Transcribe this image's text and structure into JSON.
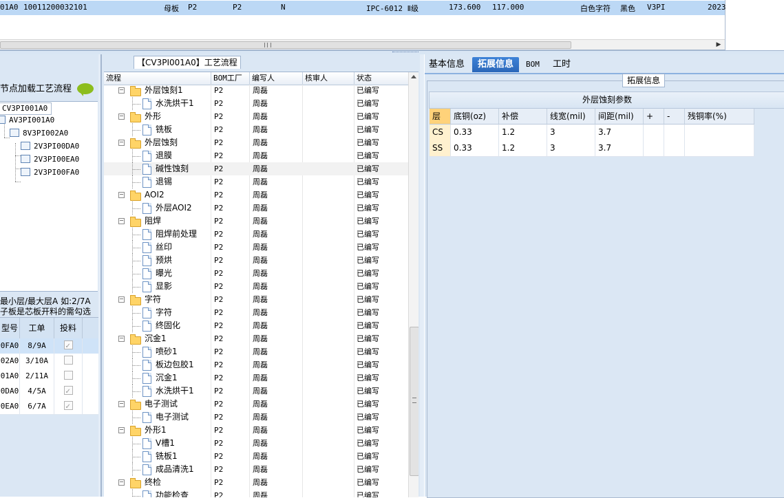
{
  "top_record": {
    "cells": [
      "01A0",
      "10011200032101",
      "母板",
      "P2",
      "P2",
      "N",
      "IPC-6012 Ⅱ级",
      "173.600",
      "117.000",
      "白色字符",
      "黑色",
      "V3PI",
      "2023"
    ]
  },
  "left_panel": {
    "hint": "节点加载工艺流程",
    "tree_tab": "CV3PI001A0",
    "tree_nodes": [
      "AV3PI001A0",
      "8V3PI002A0",
      "2V3PI00DA0",
      "2V3PI00EA0",
      "2V3PI00FA0"
    ],
    "note_line1": "最小层/最大层A 如:2/7A",
    "note_line2": "子板是芯板开料的需勾选",
    "table_headers": [
      "型号",
      "工单",
      "投料"
    ],
    "rows": [
      {
        "code": "0FA0",
        "order": "8/9A",
        "checked": true
      },
      {
        "code": "02A0",
        "order": "3/10A",
        "checked": false
      },
      {
        "code": "01A0",
        "order": "2/11A",
        "checked": false
      },
      {
        "code": "0DA0",
        "order": "4/5A",
        "checked": true
      },
      {
        "code": "0EA0",
        "order": "6/7A",
        "checked": true
      }
    ]
  },
  "mid_panel": {
    "title": "【CV3PI001A0】工艺流程",
    "headers": [
      "流程",
      "BOM工厂",
      "编写人",
      "核审人",
      "状态"
    ],
    "rows": [
      {
        "level": 0,
        "name": "外层蚀刻1",
        "factory": "P2",
        "writer": "周磊",
        "reviewer": "",
        "status": "已编写"
      },
      {
        "level": 1,
        "name": "水洗烘干1",
        "factory": "P2",
        "writer": "周磊",
        "reviewer": "",
        "status": "已编写"
      },
      {
        "level": 0,
        "name": "外形",
        "factory": "P2",
        "writer": "周磊",
        "reviewer": "",
        "status": "已编写"
      },
      {
        "level": 1,
        "name": "铣板",
        "factory": "P2",
        "writer": "周磊",
        "reviewer": "",
        "status": "已编写"
      },
      {
        "level": 0,
        "name": "外层蚀刻",
        "factory": "P2",
        "writer": "周磊",
        "reviewer": "",
        "status": "已编写"
      },
      {
        "level": 1,
        "name": "退膜",
        "factory": "P2",
        "writer": "周磊",
        "reviewer": "",
        "status": "已编写"
      },
      {
        "level": 1,
        "name": "碱性蚀刻",
        "factory": "P2",
        "writer": "周磊",
        "reviewer": "",
        "status": "已编写"
      },
      {
        "level": 1,
        "name": "退锡",
        "factory": "P2",
        "writer": "周磊",
        "reviewer": "",
        "status": "已编写"
      },
      {
        "level": 0,
        "name": "AOI2",
        "factory": "P2",
        "writer": "周磊",
        "reviewer": "",
        "status": "已编写"
      },
      {
        "level": 1,
        "name": "外层AOI2",
        "factory": "P2",
        "writer": "周磊",
        "reviewer": "",
        "status": "已编写"
      },
      {
        "level": 0,
        "name": "阻焊",
        "factory": "P2",
        "writer": "周磊",
        "reviewer": "",
        "status": "已编写"
      },
      {
        "level": 1,
        "name": "阻焊前处理",
        "factory": "P2",
        "writer": "周磊",
        "reviewer": "",
        "status": "已编写"
      },
      {
        "level": 1,
        "name": "丝印",
        "factory": "P2",
        "writer": "周磊",
        "reviewer": "",
        "status": "已编写"
      },
      {
        "level": 1,
        "name": "预烘",
        "factory": "P2",
        "writer": "周磊",
        "reviewer": "",
        "status": "已编写"
      },
      {
        "level": 1,
        "name": "曝光",
        "factory": "P2",
        "writer": "周磊",
        "reviewer": "",
        "status": "已编写"
      },
      {
        "level": 1,
        "name": "显影",
        "factory": "P2",
        "writer": "周磊",
        "reviewer": "",
        "status": "已编写"
      },
      {
        "level": 0,
        "name": "字符",
        "factory": "P2",
        "writer": "周磊",
        "reviewer": "",
        "status": "已编写"
      },
      {
        "level": 1,
        "name": "字符",
        "factory": "P2",
        "writer": "周磊",
        "reviewer": "",
        "status": "已编写"
      },
      {
        "level": 1,
        "name": "终固化",
        "factory": "P2",
        "writer": "周磊",
        "reviewer": "",
        "status": "已编写"
      },
      {
        "level": 0,
        "name": "沉金1",
        "factory": "P2",
        "writer": "周磊",
        "reviewer": "",
        "status": "已编写"
      },
      {
        "level": 1,
        "name": "喷砂1",
        "factory": "P2",
        "writer": "周磊",
        "reviewer": "",
        "status": "已编写"
      },
      {
        "level": 1,
        "name": "板边包胶1",
        "factory": "P2",
        "writer": "周磊",
        "reviewer": "",
        "status": "已编写"
      },
      {
        "level": 1,
        "name": "沉金1",
        "factory": "P2",
        "writer": "周磊",
        "reviewer": "",
        "status": "已编写"
      },
      {
        "level": 1,
        "name": "水洗烘干1",
        "factory": "P2",
        "writer": "周磊",
        "reviewer": "",
        "status": "已编写"
      },
      {
        "level": 0,
        "name": "电子测试",
        "factory": "P2",
        "writer": "周磊",
        "reviewer": "",
        "status": "已编写"
      },
      {
        "level": 1,
        "name": "电子测试",
        "factory": "P2",
        "writer": "周磊",
        "reviewer": "",
        "status": "已编写"
      },
      {
        "level": 0,
        "name": "外形1",
        "factory": "P2",
        "writer": "周磊",
        "reviewer": "",
        "status": "已编写"
      },
      {
        "level": 1,
        "name": "V槽1",
        "factory": "P2",
        "writer": "周磊",
        "reviewer": "",
        "status": "已编写"
      },
      {
        "level": 1,
        "name": "铣板1",
        "factory": "P2",
        "writer": "周磊",
        "reviewer": "",
        "status": "已编写"
      },
      {
        "level": 1,
        "name": "成品清洗1",
        "factory": "P2",
        "writer": "周磊",
        "reviewer": "",
        "status": "已编写"
      },
      {
        "level": 0,
        "name": "终检",
        "factory": "P2",
        "writer": "周磊",
        "reviewer": "",
        "status": "已编写"
      },
      {
        "level": 1,
        "name": "功能检查",
        "factory": "P2",
        "writer": "周磊",
        "reviewer": "",
        "status": "已编写"
      }
    ],
    "selected_index": 6
  },
  "right_panel": {
    "tabs": [
      "基本信息",
      "拓展信息",
      "BOM",
      "工时"
    ],
    "active_tab": 1,
    "section_label": "拓展信息",
    "table_title": "外层蚀刻参数",
    "headers": [
      "层",
      "底铜(oz)",
      "补偿",
      "线宽(mil)",
      "间距(mil)",
      "+",
      "-",
      "残铜率(%)"
    ],
    "rows": [
      [
        "CS",
        "0.33",
        "1.2",
        "3",
        "3.7",
        "",
        "",
        ""
      ],
      [
        "SS",
        "0.33",
        "1.2",
        "3",
        "3.7",
        "",
        "",
        ""
      ]
    ]
  },
  "colors": {
    "selected_row": "#bcd8f5",
    "panel_bg": "#dbe7f4",
    "active_tab": "#2b67b9",
    "layer_header": "#ffd27a",
    "folder": "#ffd467"
  }
}
